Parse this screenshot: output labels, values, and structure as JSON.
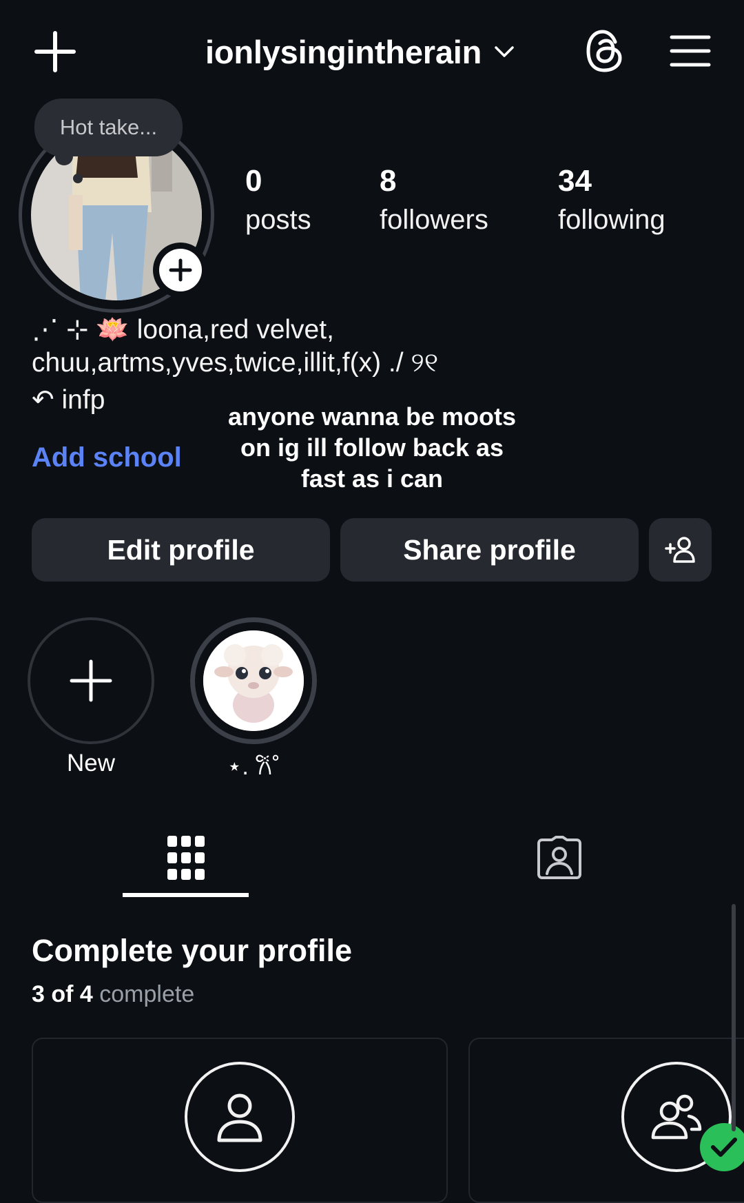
{
  "header": {
    "username": "ionlysingintherain",
    "icons": [
      "plus-icon",
      "chevron-down-icon",
      "threads-icon",
      "hamburger-menu-icon"
    ]
  },
  "profile": {
    "note": "Hot take...",
    "stats": [
      {
        "value": "0",
        "label": "posts"
      },
      {
        "value": "8",
        "label": "followers"
      },
      {
        "value": "34",
        "label": "following"
      }
    ],
    "bio": {
      "line1": "⋰ ⊹ 🪷 loona,red velvet,",
      "line2": "chuu,artms,yves,twice,illit,f(x) ./ ୨୧",
      "line3": "↶ infp"
    },
    "add_school": "Add school"
  },
  "overlay_text": "anyone wanna be moots on ig ill follow back as fast as i can",
  "buttons": {
    "edit": "Edit profile",
    "share": "Share profile"
  },
  "highlights": [
    {
      "label": "New"
    },
    {
      "label": "⋆. 𐙚˚"
    }
  ],
  "tabs": [
    "grid-icon",
    "tagged-icon"
  ],
  "complete_profile": {
    "title": "Complete your profile",
    "progress_bold": "3 of 4",
    "progress_rest": "complete",
    "completed_steps": 3,
    "total_steps": 4
  },
  "colors": {
    "background": "#0c0f14",
    "button": "#26292f",
    "link": "#5b83f5",
    "check": "#2bbf5a"
  }
}
